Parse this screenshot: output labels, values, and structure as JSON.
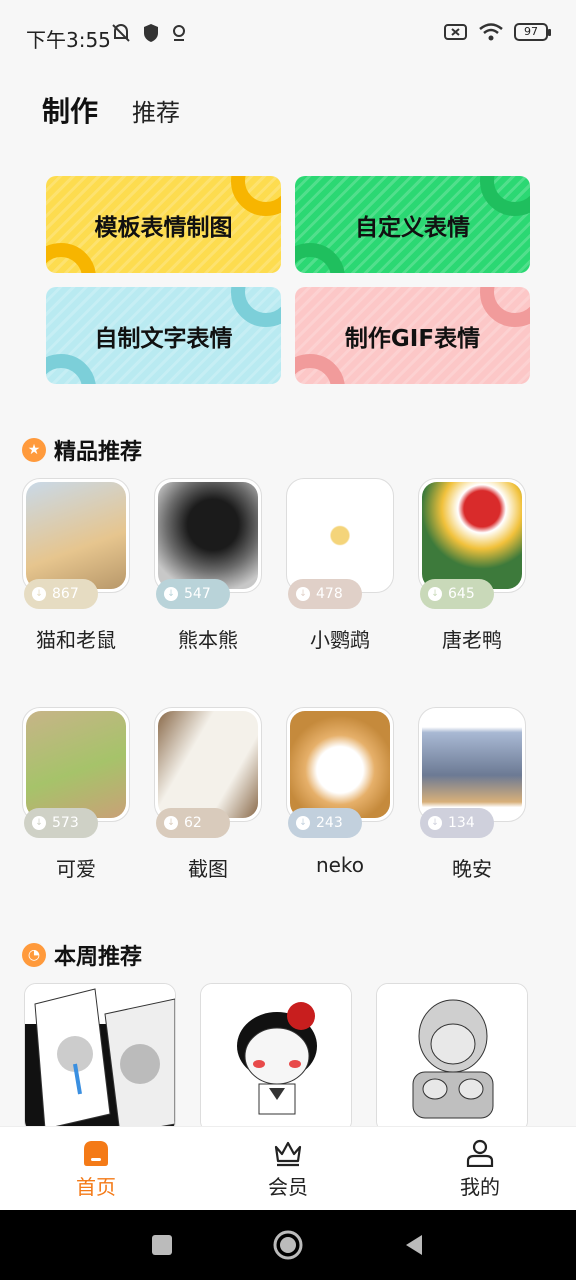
{
  "status": {
    "time": "下午3:55",
    "battery": "97"
  },
  "tabs": [
    {
      "label": "制作"
    },
    {
      "label": "推荐"
    }
  ],
  "make_cards": [
    {
      "label": "模板表情制图",
      "bg": "#fddc4f",
      "accent": "#f7b500"
    },
    {
      "label": "自定义表情",
      "bg": "#2bd873",
      "accent": "#1fbf5e"
    },
    {
      "label": "自制文字表情",
      "bg": "#b9eaf1",
      "accent": "#7ccfd9"
    },
    {
      "label": "制作GIF表情",
      "bg": "#fcc7c7",
      "accent": "#f19b9b"
    }
  ],
  "featured": {
    "title": "精品推荐",
    "items": [
      {
        "name": "猫和老鼠",
        "count": "867",
        "badge": "#e6dcc2"
      },
      {
        "name": "熊本熊",
        "count": "547",
        "badge": "#b9d3d9"
      },
      {
        "name": "小鹦鹉",
        "count": "478",
        "badge": "#e0d0c8"
      },
      {
        "name": "唐老鸭",
        "count": "645",
        "badge": "#c9d9b9"
      },
      {
        "name": "可爱",
        "count": "573",
        "badge": "#cfd1c6"
      },
      {
        "name": "截图",
        "count": "62",
        "badge": "#d9cbbc"
      },
      {
        "name": "neko",
        "count": "243",
        "badge": "#c2d0dd"
      },
      {
        "name": "晚安",
        "count": "134",
        "badge": "#cfd0dc"
      }
    ]
  },
  "weekly": {
    "title": "本周推荐"
  },
  "bottom_nav": [
    {
      "label": "首页"
    },
    {
      "label": "会员"
    },
    {
      "label": "我的"
    }
  ],
  "colors": {
    "accent": "#f47a17"
  }
}
